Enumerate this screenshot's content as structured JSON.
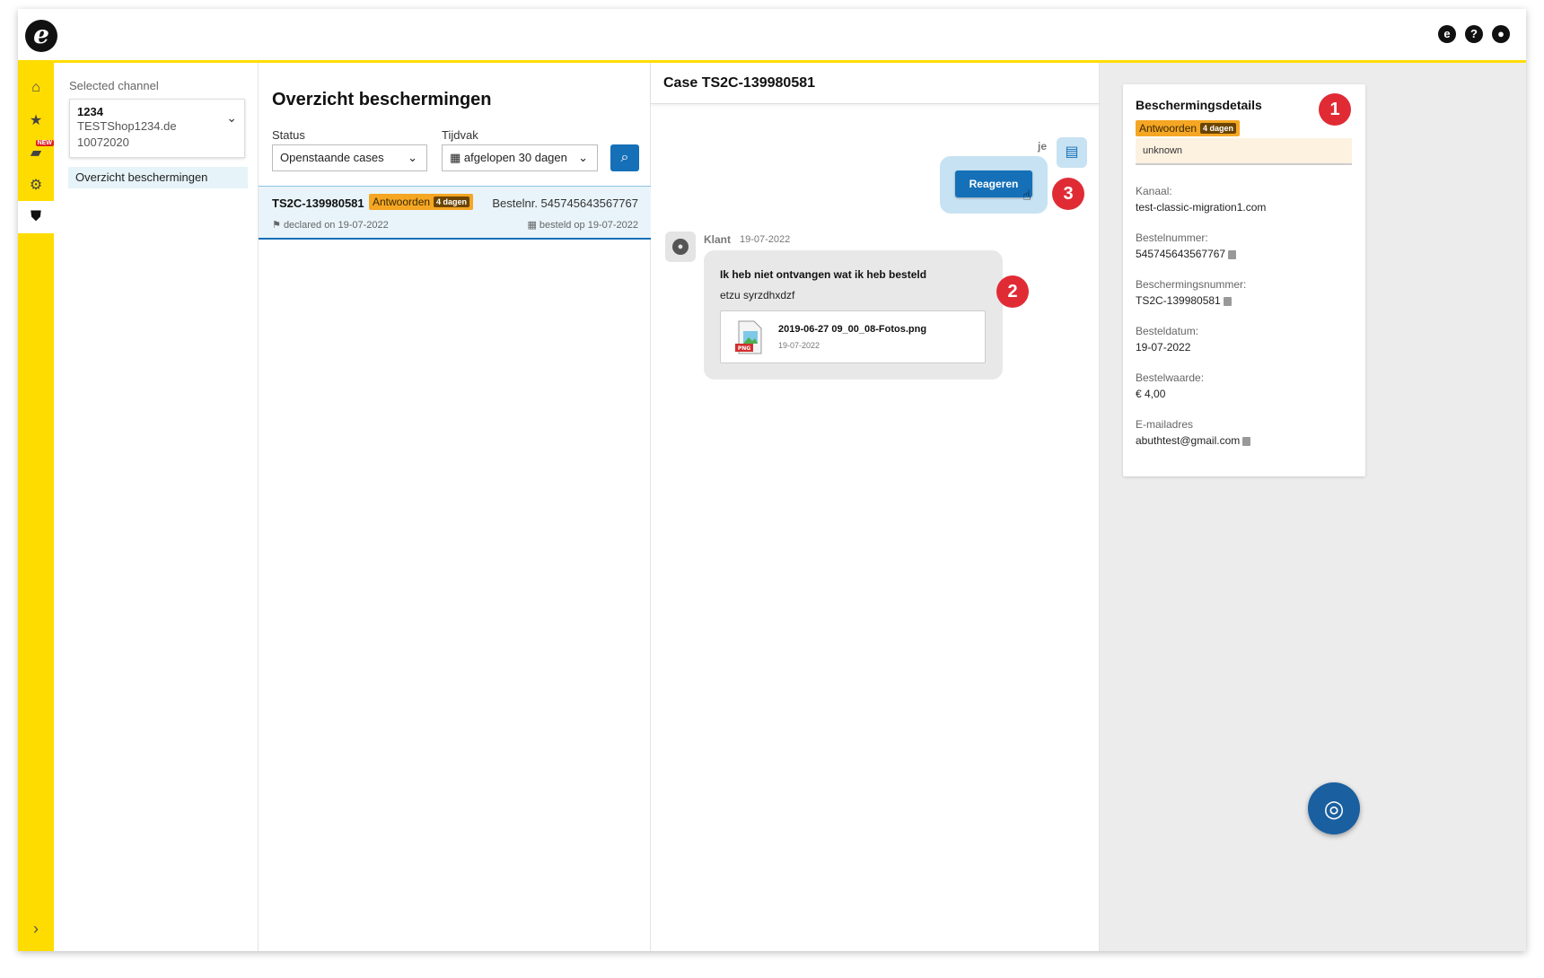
{
  "topbar": {
    "logo_icon": "elaine-logo",
    "logo_text": "e",
    "icons": [
      {
        "name": "chat-icon",
        "glyph": "e"
      },
      {
        "name": "help-icon",
        "glyph": "?"
      },
      {
        "name": "user-icon",
        "glyph": "●"
      }
    ]
  },
  "rail": {
    "items": [
      {
        "name": "home-icon",
        "glyph": "⌂"
      },
      {
        "name": "star-icon",
        "glyph": "★"
      },
      {
        "name": "stats-icon",
        "glyph": "▰",
        "badge": "NEW"
      },
      {
        "name": "gear-icon",
        "glyph": "⚙"
      },
      {
        "name": "shield-icon",
        "glyph": "⛊"
      }
    ],
    "expand_glyph": "›"
  },
  "channel": {
    "label": "Selected channel",
    "id": "1234",
    "shop": "TESTShop1234.de",
    "number": "10072020",
    "nav_item": "Overzicht beschermingen"
  },
  "list": {
    "title": "Overzicht beschermingen",
    "status_label": "Status",
    "status_value": "Openstaande cases",
    "period_label": "Tijdvak",
    "period_value": "afgelopen 30 dagen",
    "case": {
      "id": "TS2C-139980581",
      "badge": "Antwoorden",
      "badge_days": "4 dagen",
      "order": "Bestelnr. 545745643567767",
      "declared": "declared on 19-07-2022",
      "ordered": "besteld op 19-07-2022"
    }
  },
  "chat": {
    "title": "Case TS2C-139980581",
    "me_label": "je",
    "reply_button": "Reageren",
    "customer_name": "Klant",
    "customer_date": "19-07-2022",
    "message_title": "Ik heb niet ontvangen wat ik heb besteld",
    "message_body": "etzu syrzdhxdzf",
    "attachment_name": "2019-06-27 09_00_08-Fotos.png",
    "attachment_date": "19-07-2022",
    "attachment_type": "PNG"
  },
  "details": {
    "title": "Beschermingsdetails",
    "badge": "Antwoorden",
    "badge_days": "4 dagen",
    "status_text": "unknown",
    "fields": [
      {
        "label": "Kanaal:",
        "value": "test-classic-migration1.com",
        "copy": false
      },
      {
        "label": "Bestelnummer:",
        "value": "545745643567767",
        "copy": true
      },
      {
        "label": "Beschermingsnummer:",
        "value": "TS2C-139980581",
        "copy": true
      },
      {
        "label": "Besteldatum:",
        "value": "19-07-2022",
        "copy": false
      },
      {
        "label": "Bestelwaarde:",
        "value": "€ 4,00",
        "copy": false
      },
      {
        "label": "E-mailadres",
        "value": "abuthtest@gmail.com",
        "copy": true
      }
    ]
  },
  "steps": [
    "1",
    "2",
    "3"
  ],
  "colors": {
    "accent_yellow": "#ffdc00",
    "primary_blue": "#1570b8",
    "badge_orange": "#f5a623",
    "step_red": "#e02b35"
  }
}
